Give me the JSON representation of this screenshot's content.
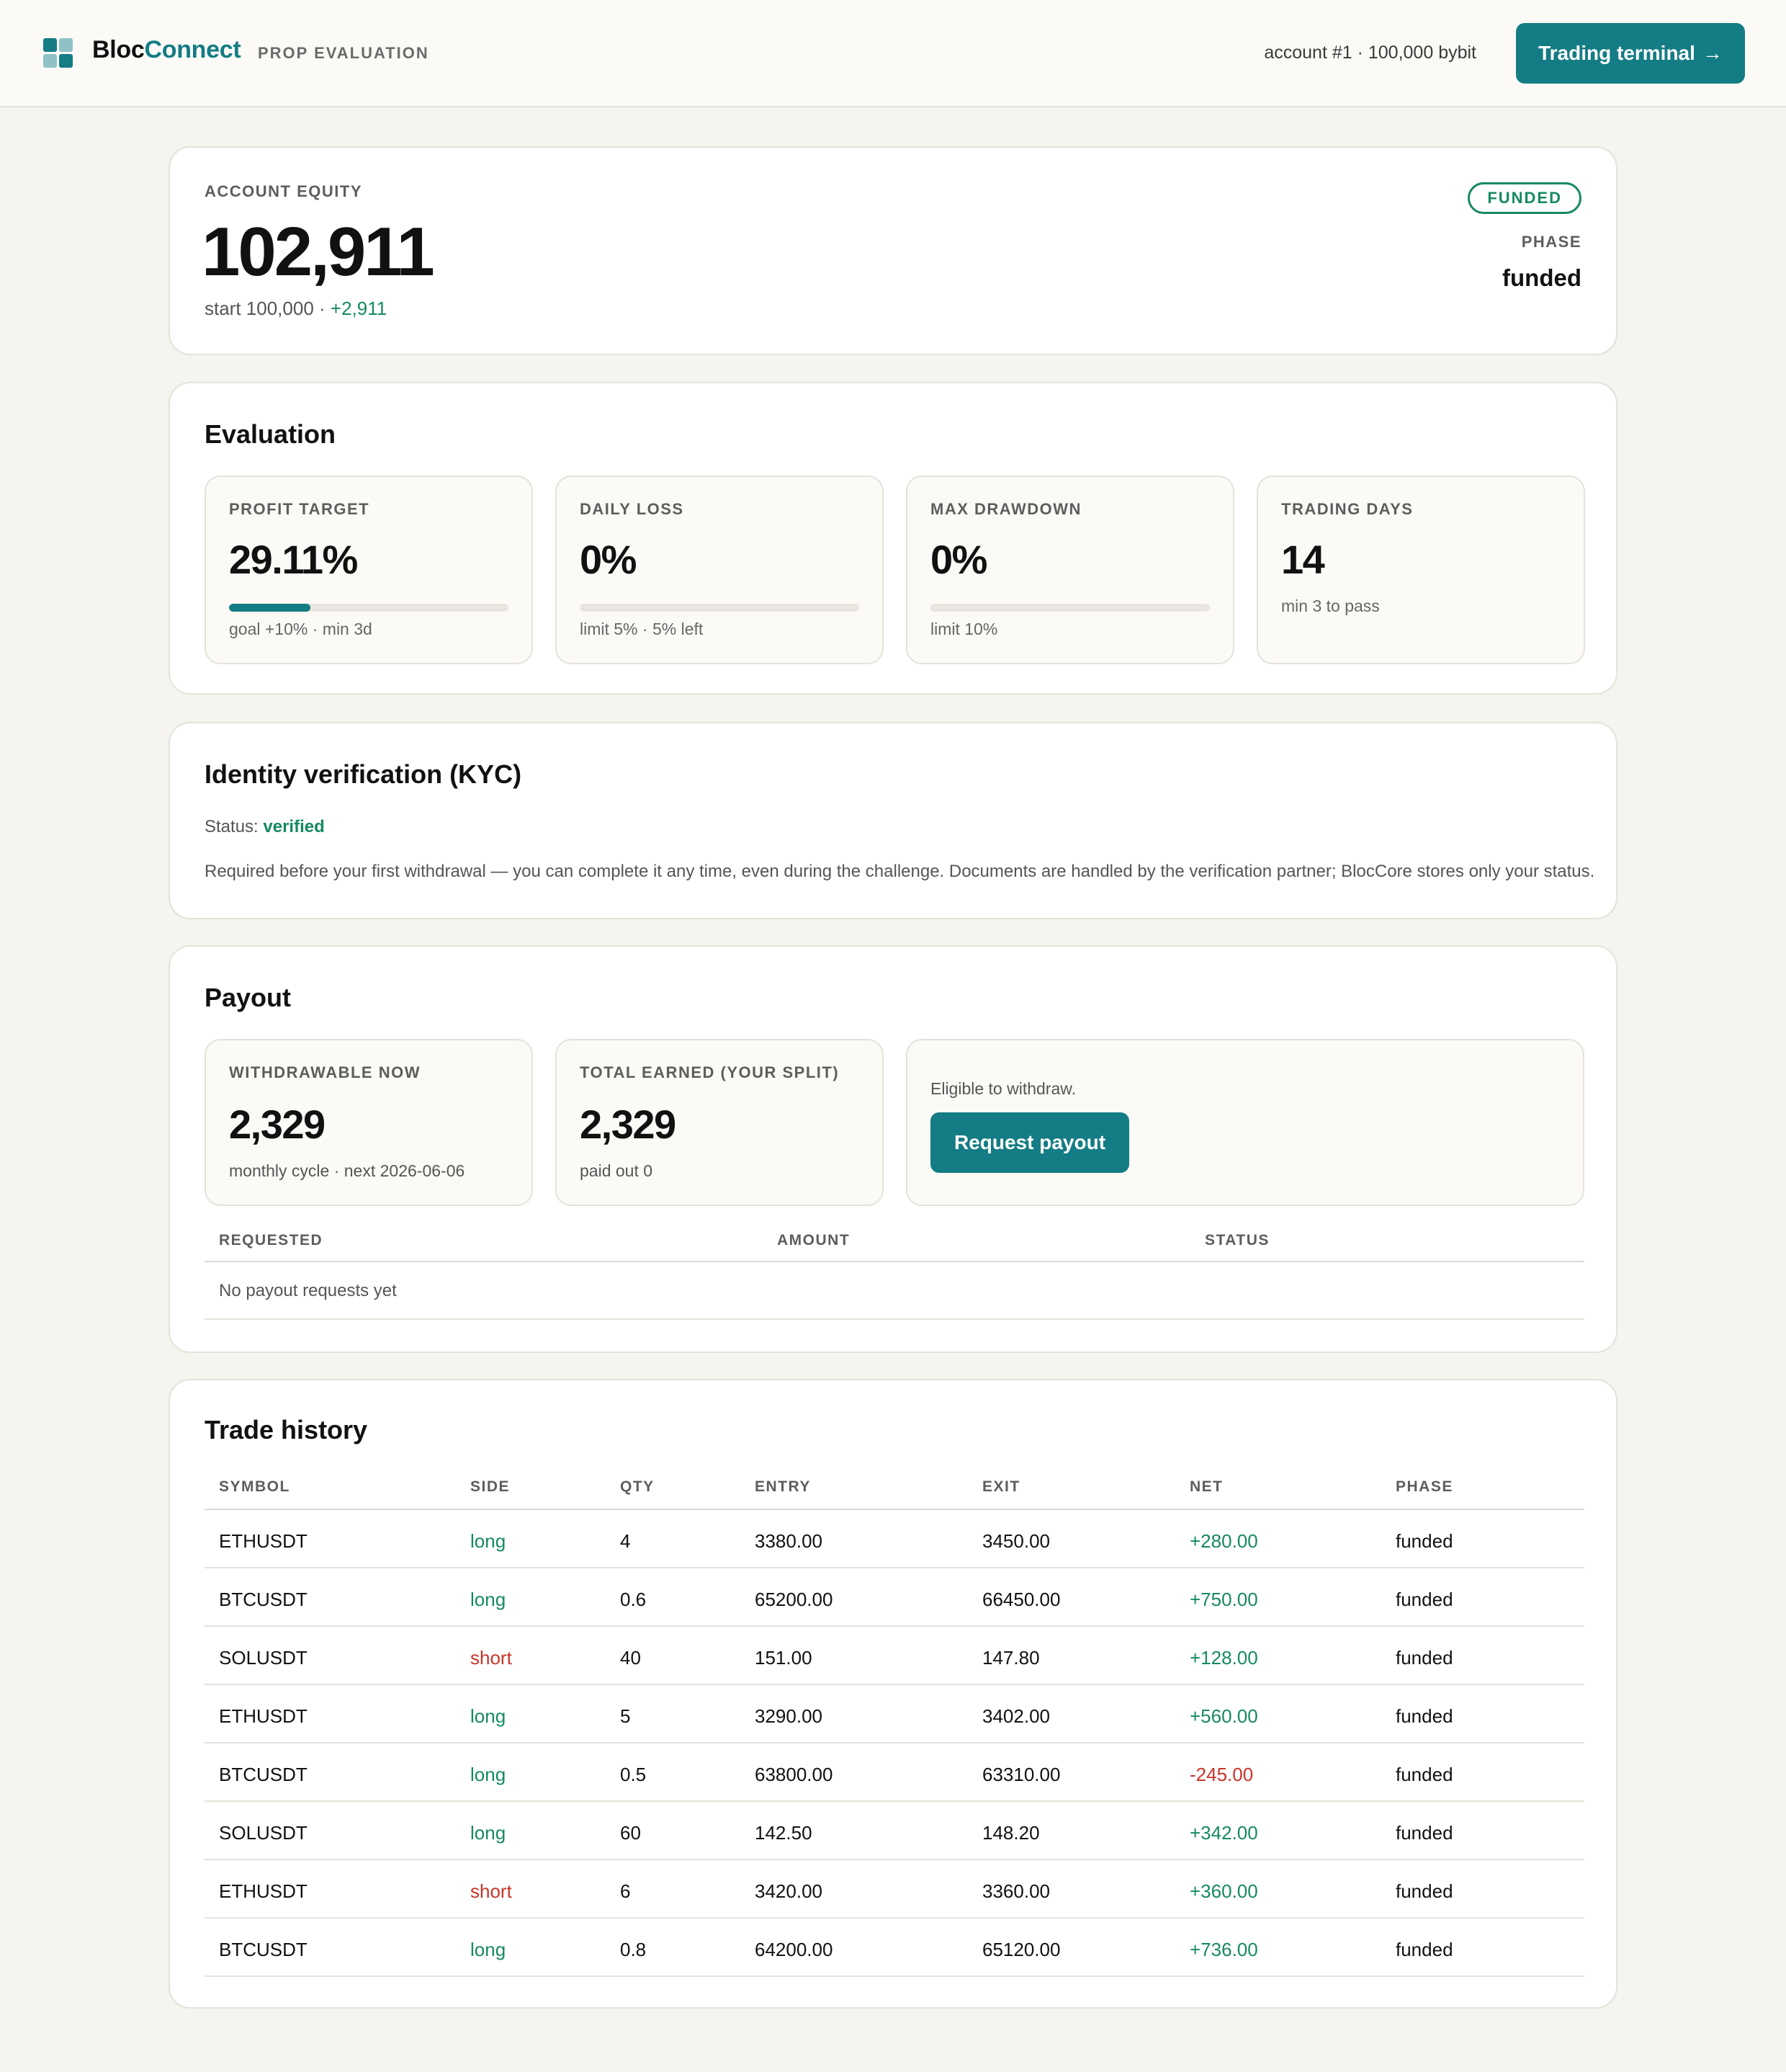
{
  "header": {
    "brand_main": "Bloc",
    "brand_accent": "Connect",
    "tagline": "PROP EVALUATION",
    "account": "account #1 · 100,000 bybit",
    "terminal_button": "Trading terminal",
    "terminal_arrow": "→",
    "colors": {
      "accent": "#147c84"
    }
  },
  "equity": {
    "label": "ACCOUNT EQUITY",
    "value": "102,911",
    "start_text": "start 100,000 · ",
    "change": "+2,911",
    "badge": "FUNDED",
    "phase_label": "PHASE",
    "phase_value": "funded"
  },
  "evaluation": {
    "title": "Evaluation",
    "metrics": [
      {
        "label": "PROFIT TARGET",
        "value": "29.11%",
        "sub": "goal +10% · min 3d",
        "progress": 0.2911
      },
      {
        "label": "DAILY LOSS",
        "value": "0%",
        "sub": "limit 5% · 5% left",
        "progress": 0
      },
      {
        "label": "MAX DRAWDOWN",
        "value": "0%",
        "sub": "limit 10%",
        "progress": 0
      },
      {
        "label": "TRADING DAYS",
        "value": "14",
        "sub": "min 3 to pass"
      }
    ]
  },
  "kyc": {
    "title": "Identity verification (KYC)",
    "status_label": "Status: ",
    "status_value": "verified",
    "note": "Required before your first withdrawal — you can complete it any time, even during the challenge. Documents are handled by the verification partner; BlocCore stores only your status."
  },
  "payout": {
    "title": "Payout",
    "withdrawable": {
      "label": "WITHDRAWABLE NOW",
      "value": "2,329",
      "sub": "monthly cycle · next 2026-06-06"
    },
    "total": {
      "label": "TOTAL EARNED (YOUR SPLIT)",
      "value": "2,329",
      "sub": "paid out 0"
    },
    "eligible_text": "Eligible to withdraw.",
    "request_button": "Request payout",
    "columns": [
      "REQUESTED",
      "AMOUNT",
      "STATUS"
    ],
    "empty_text": "No payout requests yet"
  },
  "trades": {
    "title": "Trade history",
    "columns": [
      "SYMBOL",
      "SIDE",
      "QTY",
      "ENTRY",
      "EXIT",
      "NET",
      "PHASE"
    ],
    "rows": [
      {
        "symbol": "ETHUSDT",
        "side": "long",
        "qty": "4",
        "entry": "3380.00",
        "exit": "3450.00",
        "net": "+280.00",
        "phase": "funded"
      },
      {
        "symbol": "BTCUSDT",
        "side": "long",
        "qty": "0.6",
        "entry": "65200.00",
        "exit": "66450.00",
        "net": "+750.00",
        "phase": "funded"
      },
      {
        "symbol": "SOLUSDT",
        "side": "short",
        "qty": "40",
        "entry": "151.00",
        "exit": "147.80",
        "net": "+128.00",
        "phase": "funded"
      },
      {
        "symbol": "ETHUSDT",
        "side": "long",
        "qty": "5",
        "entry": "3290.00",
        "exit": "3402.00",
        "net": "+560.00",
        "phase": "funded"
      },
      {
        "symbol": "BTCUSDT",
        "side": "long",
        "qty": "0.5",
        "entry": "63800.00",
        "exit": "63310.00",
        "net": "-245.00",
        "phase": "funded"
      },
      {
        "symbol": "SOLUSDT",
        "side": "long",
        "qty": "60",
        "entry": "142.50",
        "exit": "148.20",
        "net": "+342.00",
        "phase": "funded"
      },
      {
        "symbol": "ETHUSDT",
        "side": "short",
        "qty": "6",
        "entry": "3420.00",
        "exit": "3360.00",
        "net": "+360.00",
        "phase": "funded"
      },
      {
        "symbol": "BTCUSDT",
        "side": "long",
        "qty": "0.8",
        "entry": "64200.00",
        "exit": "65120.00",
        "net": "+736.00",
        "phase": "funded"
      }
    ]
  }
}
